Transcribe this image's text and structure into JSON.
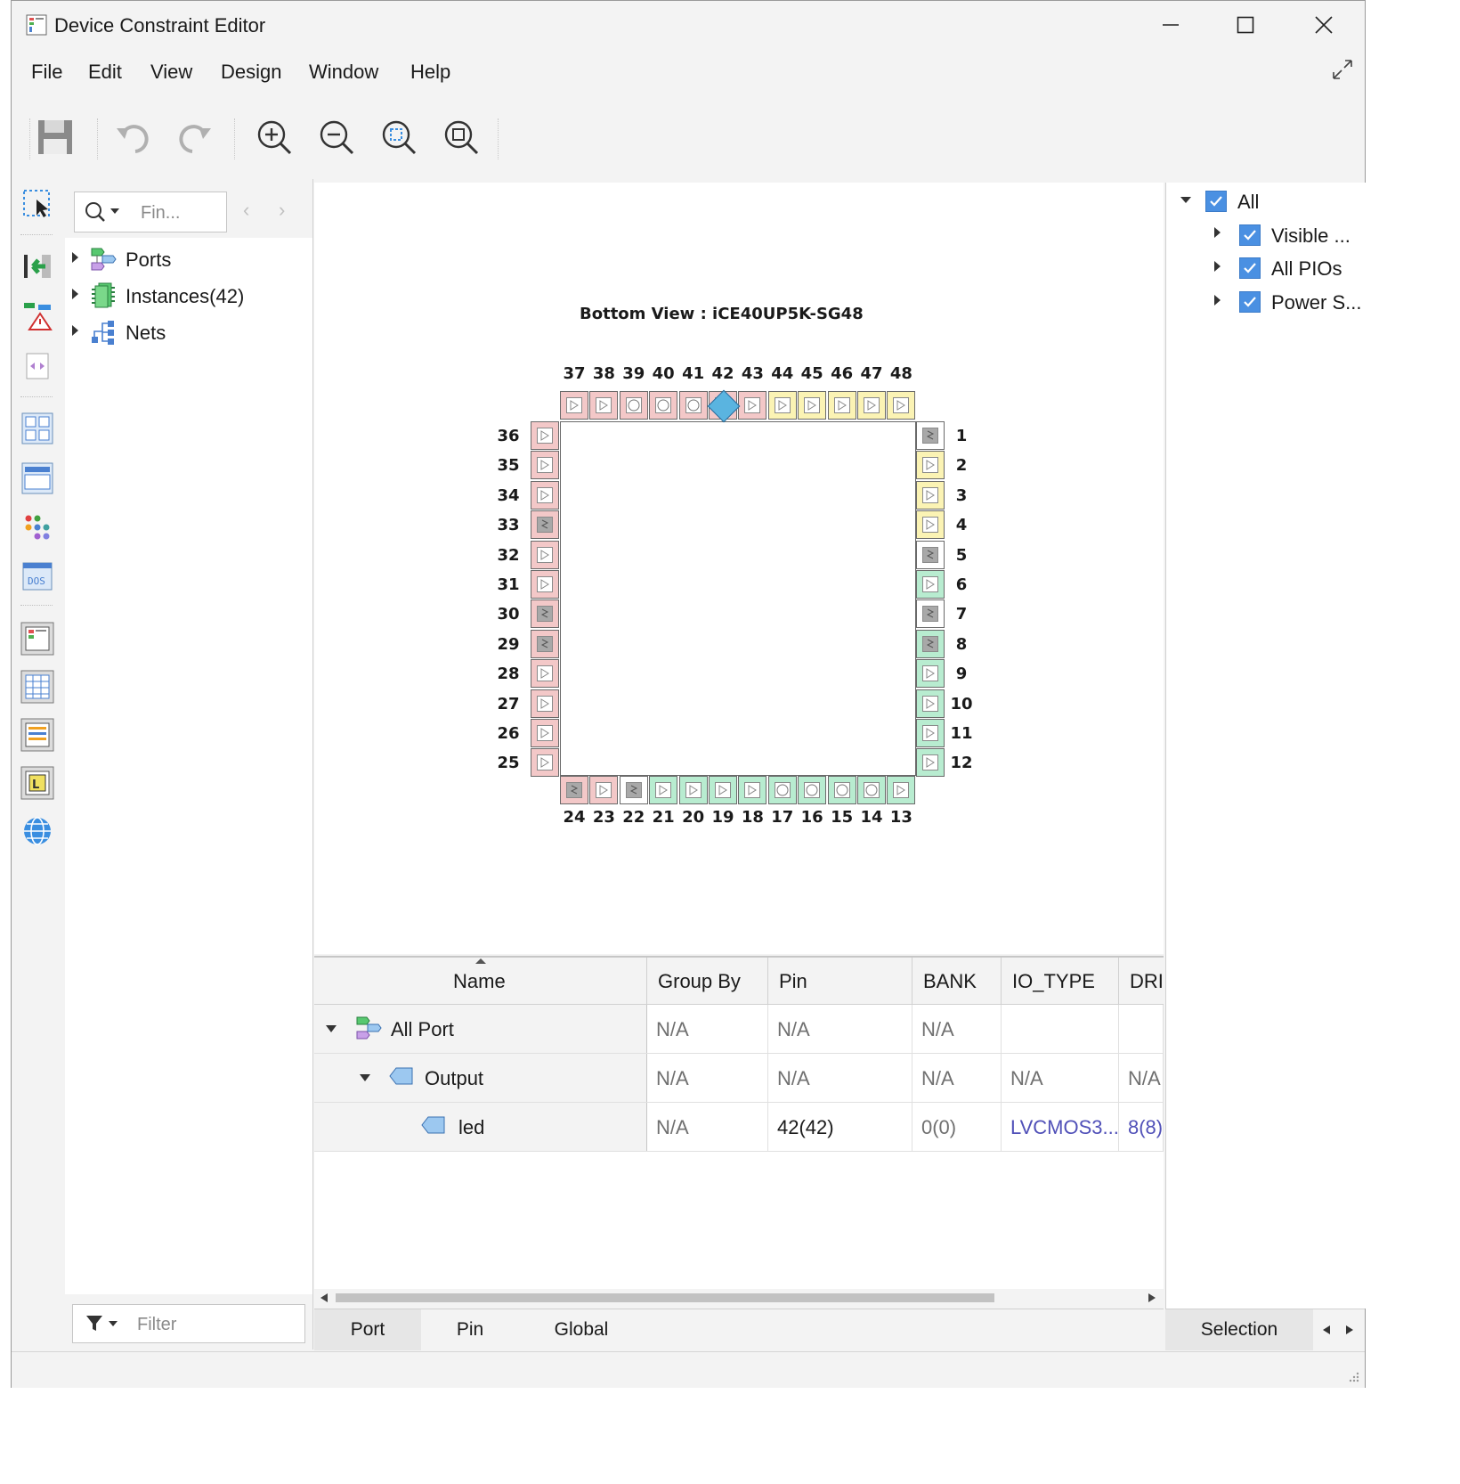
{
  "window": {
    "title": "Device Constraint Editor"
  },
  "menu": [
    "File",
    "Edit",
    "View",
    "Design",
    "Window",
    "Help"
  ],
  "toolbar": {
    "save": "save-icon",
    "undo": "undo-icon",
    "redo": "redo-icon",
    "zoom_in": "zoom-in-icon",
    "zoom_out": "zoom-out-icon",
    "zoom_fit": "zoom-fit-icon",
    "zoom_area": "zoom-area-icon"
  },
  "search": {
    "placeholder": "Fin..."
  },
  "tree": [
    {
      "label": "Ports",
      "icon": "ports-icon"
    },
    {
      "label": "Instances(42)",
      "icon": "instances-icon"
    },
    {
      "label": "Nets",
      "icon": "nets-icon"
    }
  ],
  "filter": {
    "placeholder": "Filter"
  },
  "package_view": {
    "title": "Bottom View : iCE40UP5K-SG48",
    "top_pins": [
      "37",
      "38",
      "39",
      "40",
      "41",
      "42",
      "43",
      "44",
      "45",
      "46",
      "47",
      "48"
    ],
    "top_colors": [
      "#f3c8c8",
      "#f3c8c8",
      "#f3c8c8",
      "#f3c8c8",
      "#f3c8c8",
      "#f3c8c8",
      "#f3c8c8",
      "#fbf3b4",
      "#fbf3b4",
      "#fbf3b4",
      "#fbf3b4",
      "#fbf3b4"
    ],
    "left_pins": [
      "36",
      "35",
      "34",
      "33",
      "32",
      "31",
      "30",
      "29",
      "28",
      "27",
      "26",
      "25"
    ],
    "right_pins": [
      "1",
      "2",
      "3",
      "4",
      "5",
      "6",
      "7",
      "8",
      "9",
      "10",
      "11",
      "12"
    ],
    "right_colors": [
      "#ffffff",
      "#fbf3b4",
      "#fbf3b4",
      "#fbf3b4",
      "#ffffff",
      "#b8ecd0",
      "#ffffff",
      "#b8ecd0",
      "#b8ecd0",
      "#b8ecd0",
      "#b8ecd0",
      "#b8ecd0"
    ],
    "bottom_pins": [
      "24",
      "23",
      "22",
      "21",
      "20",
      "19",
      "18",
      "17",
      "16",
      "15",
      "14",
      "13"
    ],
    "bottom_colors": [
      "#f3c8c8",
      "#f3c8c8",
      "#ffffff",
      "#b8ecd0",
      "#b8ecd0",
      "#b8ecd0",
      "#b8ecd0",
      "#b8ecd0",
      "#b8ecd0",
      "#b8ecd0",
      "#b8ecd0",
      "#b8ecd0"
    ],
    "left_color": "#f3c8c8",
    "highlight_color": "#5ab4e0"
  },
  "grid": {
    "columns": [
      "Name",
      "Group By",
      "Pin",
      "BANK",
      "IO_TYPE",
      "DRI"
    ],
    "rows": [
      {
        "name": "All Port",
        "group_by": "N/A",
        "pin": "N/A",
        "bank": "N/A",
        "io_type": "",
        "drive": ""
      },
      {
        "name": "Output",
        "group_by": "N/A",
        "pin": "N/A",
        "bank": "N/A",
        "io_type": "N/A",
        "drive": "N/A"
      },
      {
        "name": "led",
        "group_by": "N/A",
        "pin": "42(42)",
        "bank": "0(0)",
        "io_type": "LVCMOS3...",
        "drive": "8(8)"
      }
    ]
  },
  "tabs": [
    "Port",
    "Pin",
    "Global"
  ],
  "right_tree": [
    {
      "label": "All"
    },
    {
      "label": "Visible ..."
    },
    {
      "label": "All PIOs"
    },
    {
      "label": "Power S..."
    }
  ],
  "selection_tab": "Selection"
}
